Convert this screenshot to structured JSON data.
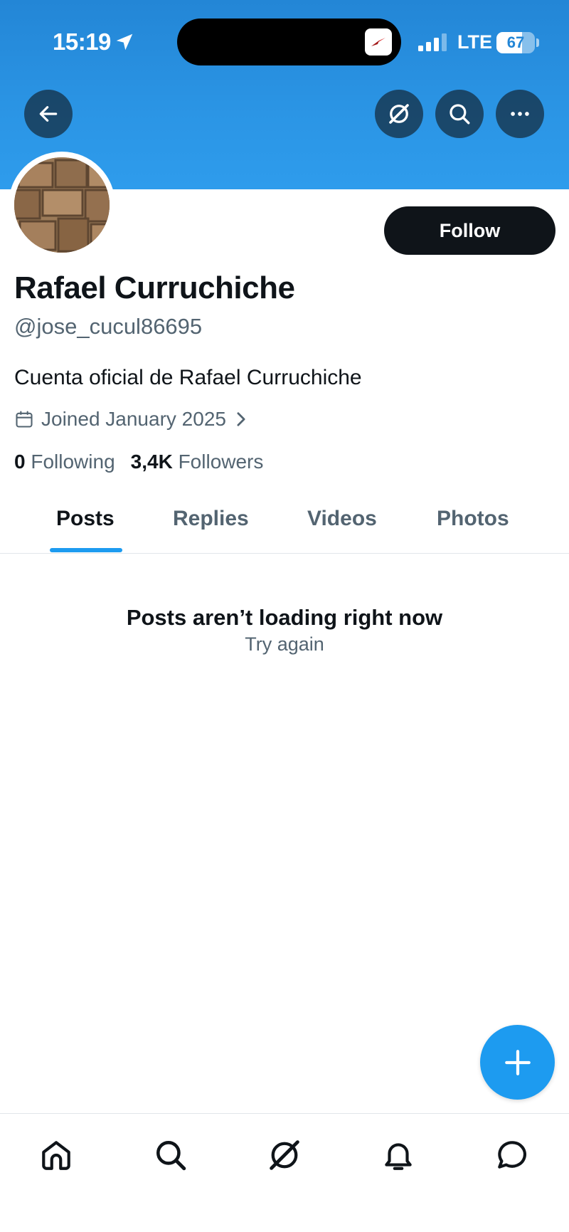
{
  "status_bar": {
    "time": "15:19",
    "network": "LTE",
    "battery_percent": "67",
    "battery_level": 0.67
  },
  "header": {
    "back_icon": "arrow-left-icon",
    "grok_icon": "grok-icon",
    "search_icon": "search-icon",
    "more_icon": "more-horizontal-icon"
  },
  "profile": {
    "name": "Rafael Curruchiche",
    "handle": "@jose_cucul86695",
    "bio": "Cuenta oficial de Rafael Curruchiche",
    "joined": "Joined January 2025",
    "following_count": "0",
    "following_label": "Following",
    "followers_count": "3,4K",
    "followers_label": "Followers",
    "follow_label": "Follow"
  },
  "tabs": [
    {
      "label": "Posts",
      "active": true
    },
    {
      "label": "Replies",
      "active": false
    },
    {
      "label": "Videos",
      "active": false
    },
    {
      "label": "Photos",
      "active": false
    }
  ],
  "content": {
    "empty_title": "Posts aren’t loading right now",
    "retry_label": "Try again"
  },
  "bottom_nav": [
    "home-icon",
    "search-icon",
    "grok-icon",
    "notifications-icon",
    "messages-icon"
  ],
  "colors": {
    "accent": "#1d9bf0",
    "banner": "#2b95e5",
    "text_primary": "#0f1419",
    "text_secondary": "#536471"
  }
}
